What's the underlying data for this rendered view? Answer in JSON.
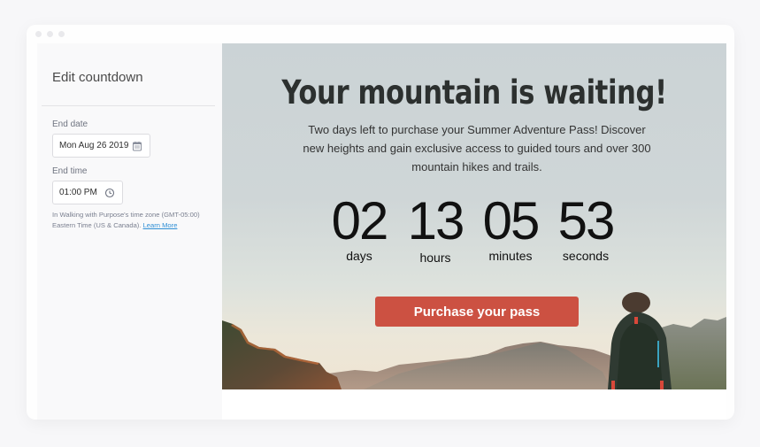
{
  "window": {
    "controls": [
      "close",
      "minimize",
      "maximize"
    ]
  },
  "sidebar": {
    "title": "Edit countdown",
    "end_date": {
      "label": "End date",
      "value": "Mon Aug 26 2019",
      "icon": "calendar-icon"
    },
    "end_time": {
      "label": "End time",
      "value": "01:00 PM",
      "icon": "clock-icon"
    },
    "timezone_note": "In Walking with Purpose's time zone (GMT-05:00) Eastern Time (US & Canada).",
    "learn_more_label": "Learn More"
  },
  "preview": {
    "headline": "Your mountain is waiting!",
    "subtext": "Two days left to purchase your Summer Adventure Pass! Discover new heights and gain exclusive access to guided tours and over 300 mountain hikes and trails.",
    "countdown": {
      "days": {
        "value": "02",
        "label": "days"
      },
      "hours": {
        "value": "13",
        "label": "hours"
      },
      "minutes": {
        "value": "05",
        "label": "minutes"
      },
      "seconds": {
        "value": "53",
        "label": "seconds"
      }
    },
    "cta_label": "Purchase your pass",
    "colors": {
      "cta": "#cc5142",
      "headline": "#2c302f",
      "link": "#2f8fd5"
    }
  }
}
